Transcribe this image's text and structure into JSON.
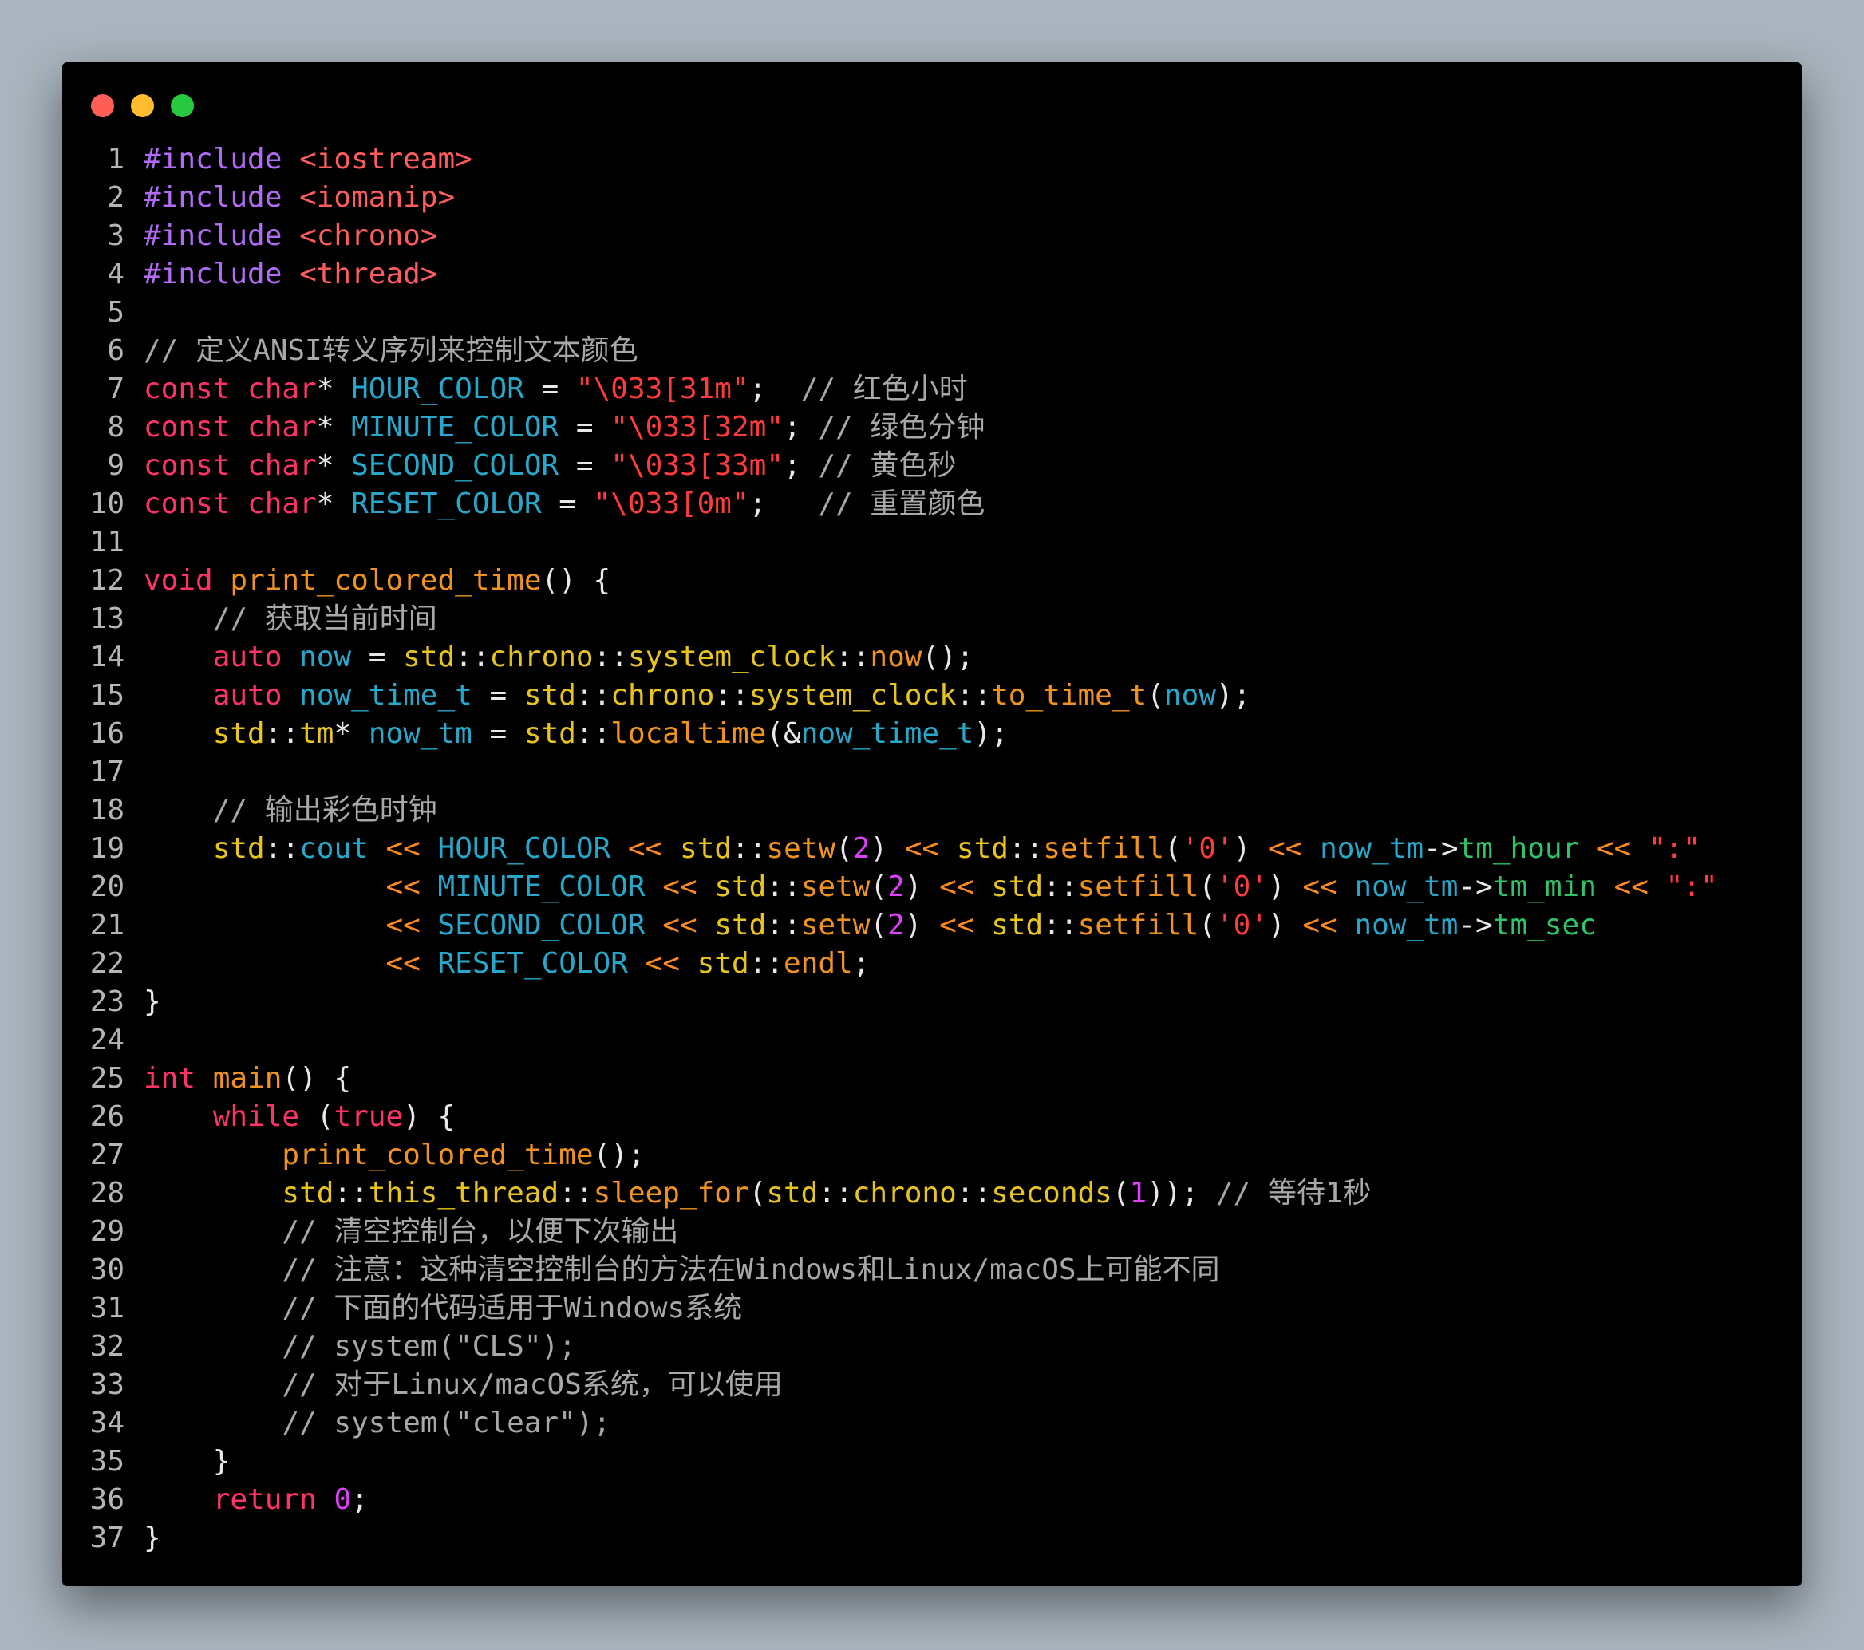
{
  "window": {
    "controls": [
      "close",
      "minimize",
      "maximize"
    ],
    "colors": {
      "close": "#ff5f57",
      "minimize": "#febc2e",
      "maximize": "#28c840",
      "background": "#000000",
      "page_background": "#a9b4be"
    }
  },
  "token_colors": {
    "pp": "#b16cf5",
    "hdr": "#ff5d5d",
    "kw": "#ff3366",
    "fn": "#f0931e",
    "var": "#27a7c9",
    "str": "#ff3b3b",
    "num": "#e040fb",
    "ns": "#e8c51d",
    "mem": "#2fc46a",
    "cmt": "#a8a8a8",
    "op": "#ff8a1e",
    "pun": "#e8e8e8"
  },
  "code": {
    "language": "C++",
    "lines": [
      {
        "n": "1",
        "tokens": [
          [
            "pp",
            "#include"
          ],
          [
            "pun",
            " "
          ],
          [
            "hdr",
            "<iostream>"
          ]
        ]
      },
      {
        "n": "2",
        "tokens": [
          [
            "pp",
            "#include"
          ],
          [
            "pun",
            " "
          ],
          [
            "hdr",
            "<iomanip>"
          ]
        ]
      },
      {
        "n": "3",
        "tokens": [
          [
            "pp",
            "#include"
          ],
          [
            "pun",
            " "
          ],
          [
            "hdr",
            "<chrono>"
          ]
        ]
      },
      {
        "n": "4",
        "tokens": [
          [
            "pp",
            "#include"
          ],
          [
            "pun",
            " "
          ],
          [
            "hdr",
            "<thread>"
          ]
        ]
      },
      {
        "n": "5",
        "tokens": []
      },
      {
        "n": "6",
        "tokens": [
          [
            "cmt",
            "// 定义ANSI转义序列来控制文本颜色"
          ]
        ]
      },
      {
        "n": "7",
        "tokens": [
          [
            "kw",
            "const"
          ],
          [
            "pun",
            " "
          ],
          [
            "kw",
            "char"
          ],
          [
            "pun",
            "* "
          ],
          [
            "var",
            "HOUR_COLOR"
          ],
          [
            "pun",
            " = "
          ],
          [
            "str",
            "\"\\033[31m\""
          ],
          [
            "pun",
            ";  "
          ],
          [
            "cmt",
            "// 红色小时"
          ]
        ]
      },
      {
        "n": "8",
        "tokens": [
          [
            "kw",
            "const"
          ],
          [
            "pun",
            " "
          ],
          [
            "kw",
            "char"
          ],
          [
            "pun",
            "* "
          ],
          [
            "var",
            "MINUTE_COLOR"
          ],
          [
            "pun",
            " = "
          ],
          [
            "str",
            "\"\\033[32m\""
          ],
          [
            "pun",
            "; "
          ],
          [
            "cmt",
            "// 绿色分钟"
          ]
        ]
      },
      {
        "n": "9",
        "tokens": [
          [
            "kw",
            "const"
          ],
          [
            "pun",
            " "
          ],
          [
            "kw",
            "char"
          ],
          [
            "pun",
            "* "
          ],
          [
            "var",
            "SECOND_COLOR"
          ],
          [
            "pun",
            " = "
          ],
          [
            "str",
            "\"\\033[33m\""
          ],
          [
            "pun",
            "; "
          ],
          [
            "cmt",
            "// 黄色秒"
          ]
        ]
      },
      {
        "n": "10",
        "tokens": [
          [
            "kw",
            "const"
          ],
          [
            "pun",
            " "
          ],
          [
            "kw",
            "char"
          ],
          [
            "pun",
            "* "
          ],
          [
            "var",
            "RESET_COLOR"
          ],
          [
            "pun",
            " = "
          ],
          [
            "str",
            "\"\\033[0m\""
          ],
          [
            "pun",
            ";   "
          ],
          [
            "cmt",
            "// 重置颜色"
          ]
        ]
      },
      {
        "n": "11",
        "tokens": []
      },
      {
        "n": "12",
        "tokens": [
          [
            "kw",
            "void"
          ],
          [
            "pun",
            " "
          ],
          [
            "fn",
            "print_colored_time"
          ],
          [
            "pun",
            "() {"
          ]
        ]
      },
      {
        "n": "13",
        "tokens": [
          [
            "pun",
            "    "
          ],
          [
            "cmt",
            "// 获取当前时间"
          ]
        ]
      },
      {
        "n": "14",
        "tokens": [
          [
            "pun",
            "    "
          ],
          [
            "kw",
            "auto"
          ],
          [
            "pun",
            " "
          ],
          [
            "var",
            "now"
          ],
          [
            "pun",
            " = "
          ],
          [
            "ns",
            "std"
          ],
          [
            "pun",
            "::"
          ],
          [
            "ns",
            "chrono"
          ],
          [
            "pun",
            "::"
          ],
          [
            "ns",
            "system_clock"
          ],
          [
            "pun",
            "::"
          ],
          [
            "fn",
            "now"
          ],
          [
            "pun",
            "();"
          ]
        ]
      },
      {
        "n": "15",
        "tokens": [
          [
            "pun",
            "    "
          ],
          [
            "kw",
            "auto"
          ],
          [
            "pun",
            " "
          ],
          [
            "var",
            "now_time_t"
          ],
          [
            "pun",
            " = "
          ],
          [
            "ns",
            "std"
          ],
          [
            "pun",
            "::"
          ],
          [
            "ns",
            "chrono"
          ],
          [
            "pun",
            "::"
          ],
          [
            "ns",
            "system_clock"
          ],
          [
            "pun",
            "::"
          ],
          [
            "fn",
            "to_time_t"
          ],
          [
            "pun",
            "("
          ],
          [
            "var",
            "now"
          ],
          [
            "pun",
            ");"
          ]
        ]
      },
      {
        "n": "16",
        "tokens": [
          [
            "pun",
            "    "
          ],
          [
            "ns",
            "std"
          ],
          [
            "pun",
            "::"
          ],
          [
            "ns",
            "tm"
          ],
          [
            "pun",
            "* "
          ],
          [
            "var",
            "now_tm"
          ],
          [
            "pun",
            " = "
          ],
          [
            "ns",
            "std"
          ],
          [
            "pun",
            "::"
          ],
          [
            "fn",
            "localtime"
          ],
          [
            "pun",
            "(&"
          ],
          [
            "var",
            "now_time_t"
          ],
          [
            "pun",
            ");"
          ]
        ]
      },
      {
        "n": "17",
        "tokens": []
      },
      {
        "n": "18",
        "tokens": [
          [
            "pun",
            "    "
          ],
          [
            "cmt",
            "// 输出彩色时钟"
          ]
        ]
      },
      {
        "n": "19",
        "tokens": [
          [
            "pun",
            "    "
          ],
          [
            "ns",
            "std"
          ],
          [
            "pun",
            "::"
          ],
          [
            "var",
            "cout"
          ],
          [
            "pun",
            " "
          ],
          [
            "op",
            "<<"
          ],
          [
            "pun",
            " "
          ],
          [
            "var",
            "HOUR_COLOR"
          ],
          [
            "pun",
            " "
          ],
          [
            "op",
            "<<"
          ],
          [
            "pun",
            " "
          ],
          [
            "ns",
            "std"
          ],
          [
            "pun",
            "::"
          ],
          [
            "fn",
            "setw"
          ],
          [
            "pun",
            "("
          ],
          [
            "num",
            "2"
          ],
          [
            "pun",
            ") "
          ],
          [
            "op",
            "<<"
          ],
          [
            "pun",
            " "
          ],
          [
            "ns",
            "std"
          ],
          [
            "pun",
            "::"
          ],
          [
            "fn",
            "setfill"
          ],
          [
            "pun",
            "("
          ],
          [
            "str",
            "'0'"
          ],
          [
            "pun",
            ") "
          ],
          [
            "op",
            "<<"
          ],
          [
            "pun",
            " "
          ],
          [
            "var",
            "now_tm"
          ],
          [
            "pun",
            "->"
          ],
          [
            "mem",
            "tm_hour"
          ],
          [
            "pun",
            " "
          ],
          [
            "op",
            "<<"
          ],
          [
            "pun",
            " "
          ],
          [
            "str",
            "\":\""
          ]
        ]
      },
      {
        "n": "20",
        "tokens": [
          [
            "pun",
            "              "
          ],
          [
            "op",
            "<<"
          ],
          [
            "pun",
            " "
          ],
          [
            "var",
            "MINUTE_COLOR"
          ],
          [
            "pun",
            " "
          ],
          [
            "op",
            "<<"
          ],
          [
            "pun",
            " "
          ],
          [
            "ns",
            "std"
          ],
          [
            "pun",
            "::"
          ],
          [
            "fn",
            "setw"
          ],
          [
            "pun",
            "("
          ],
          [
            "num",
            "2"
          ],
          [
            "pun",
            ") "
          ],
          [
            "op",
            "<<"
          ],
          [
            "pun",
            " "
          ],
          [
            "ns",
            "std"
          ],
          [
            "pun",
            "::"
          ],
          [
            "fn",
            "setfill"
          ],
          [
            "pun",
            "("
          ],
          [
            "str",
            "'0'"
          ],
          [
            "pun",
            ") "
          ],
          [
            "op",
            "<<"
          ],
          [
            "pun",
            " "
          ],
          [
            "var",
            "now_tm"
          ],
          [
            "pun",
            "->"
          ],
          [
            "mem",
            "tm_min"
          ],
          [
            "pun",
            " "
          ],
          [
            "op",
            "<<"
          ],
          [
            "pun",
            " "
          ],
          [
            "str",
            "\":\""
          ]
        ]
      },
      {
        "n": "21",
        "tokens": [
          [
            "pun",
            "              "
          ],
          [
            "op",
            "<<"
          ],
          [
            "pun",
            " "
          ],
          [
            "var",
            "SECOND_COLOR"
          ],
          [
            "pun",
            " "
          ],
          [
            "op",
            "<<"
          ],
          [
            "pun",
            " "
          ],
          [
            "ns",
            "std"
          ],
          [
            "pun",
            "::"
          ],
          [
            "fn",
            "setw"
          ],
          [
            "pun",
            "("
          ],
          [
            "num",
            "2"
          ],
          [
            "pun",
            ") "
          ],
          [
            "op",
            "<<"
          ],
          [
            "pun",
            " "
          ],
          [
            "ns",
            "std"
          ],
          [
            "pun",
            "::"
          ],
          [
            "fn",
            "setfill"
          ],
          [
            "pun",
            "("
          ],
          [
            "str",
            "'0'"
          ],
          [
            "pun",
            ") "
          ],
          [
            "op",
            "<<"
          ],
          [
            "pun",
            " "
          ],
          [
            "var",
            "now_tm"
          ],
          [
            "pun",
            "->"
          ],
          [
            "mem",
            "tm_sec"
          ]
        ]
      },
      {
        "n": "22",
        "tokens": [
          [
            "pun",
            "              "
          ],
          [
            "op",
            "<<"
          ],
          [
            "pun",
            " "
          ],
          [
            "var",
            "RESET_COLOR"
          ],
          [
            "pun",
            " "
          ],
          [
            "op",
            "<<"
          ],
          [
            "pun",
            " "
          ],
          [
            "ns",
            "std"
          ],
          [
            "pun",
            "::"
          ],
          [
            "fn",
            "endl"
          ],
          [
            "pun",
            ";"
          ]
        ]
      },
      {
        "n": "23",
        "tokens": [
          [
            "pun",
            "}"
          ]
        ]
      },
      {
        "n": "24",
        "tokens": []
      },
      {
        "n": "25",
        "tokens": [
          [
            "kw",
            "int"
          ],
          [
            "pun",
            " "
          ],
          [
            "fn",
            "main"
          ],
          [
            "pun",
            "() {"
          ]
        ]
      },
      {
        "n": "26",
        "tokens": [
          [
            "pun",
            "    "
          ],
          [
            "kw",
            "while"
          ],
          [
            "pun",
            " ("
          ],
          [
            "kw",
            "true"
          ],
          [
            "pun",
            ") {"
          ]
        ]
      },
      {
        "n": "27",
        "tokens": [
          [
            "pun",
            "        "
          ],
          [
            "fn",
            "print_colored_time"
          ],
          [
            "pun",
            "();"
          ]
        ]
      },
      {
        "n": "28",
        "tokens": [
          [
            "pun",
            "        "
          ],
          [
            "ns",
            "std"
          ],
          [
            "pun",
            "::"
          ],
          [
            "ns",
            "this_thread"
          ],
          [
            "pun",
            "::"
          ],
          [
            "fn",
            "sleep_for"
          ],
          [
            "pun",
            "("
          ],
          [
            "ns",
            "std"
          ],
          [
            "pun",
            "::"
          ],
          [
            "ns",
            "chrono"
          ],
          [
            "pun",
            "::"
          ],
          [
            "ns",
            "seconds"
          ],
          [
            "pun",
            "("
          ],
          [
            "num",
            "1"
          ],
          [
            "pun",
            ")); "
          ],
          [
            "cmt",
            "// 等待1秒"
          ]
        ]
      },
      {
        "n": "29",
        "tokens": [
          [
            "pun",
            "        "
          ],
          [
            "cmt",
            "// 清空控制台，以便下次输出"
          ]
        ]
      },
      {
        "n": "30",
        "tokens": [
          [
            "pun",
            "        "
          ],
          [
            "cmt",
            "// 注意：这种清空控制台的方法在Windows和Linux/macOS上可能不同"
          ]
        ]
      },
      {
        "n": "31",
        "tokens": [
          [
            "pun",
            "        "
          ],
          [
            "cmt",
            "// 下面的代码适用于Windows系统"
          ]
        ]
      },
      {
        "n": "32",
        "tokens": [
          [
            "pun",
            "        "
          ],
          [
            "cmt",
            "// system(\"CLS\");"
          ]
        ]
      },
      {
        "n": "33",
        "tokens": [
          [
            "pun",
            "        "
          ],
          [
            "cmt",
            "// 对于Linux/macOS系统，可以使用"
          ]
        ]
      },
      {
        "n": "34",
        "tokens": [
          [
            "pun",
            "        "
          ],
          [
            "cmt",
            "// system(\"clear\");"
          ]
        ]
      },
      {
        "n": "35",
        "tokens": [
          [
            "pun",
            "    }"
          ]
        ]
      },
      {
        "n": "36",
        "tokens": [
          [
            "pun",
            "    "
          ],
          [
            "kw",
            "return"
          ],
          [
            "pun",
            " "
          ],
          [
            "num",
            "0"
          ],
          [
            "pun",
            ";"
          ]
        ]
      },
      {
        "n": "37",
        "tokens": [
          [
            "pun",
            "}"
          ]
        ]
      }
    ]
  }
}
